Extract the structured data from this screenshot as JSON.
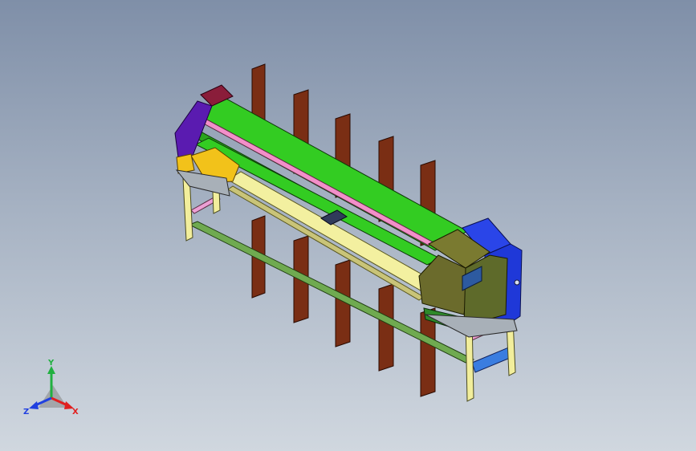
{
  "viewport": {
    "background_top": "#7f8fa8",
    "background_bottom": "#d0d7df"
  },
  "triad": {
    "x_label": "X",
    "y_label": "Y",
    "z_label": "Z",
    "x_color": "#e02020",
    "y_color": "#20b040",
    "z_color": "#2040e0"
  },
  "colors": {
    "frame": "#f2ee9c",
    "frame_pink": "#ec9fd4",
    "frame_green": "#6faa50",
    "top_rail": "#33cc22",
    "roller": "#f3f0a0",
    "pink_rail": "#f28fc9",
    "post": "#6b2a12",
    "post_light": "#a6542a",
    "left_cap": "#5a1bb0",
    "left_cap_top": "#8a1d3a",
    "left_yellow": "#f2c21a",
    "right_box": "#6b6b2c",
    "right_blue": "#2a45e8",
    "right_screen": "#2d5aa0",
    "right_green": "#2e8a2a",
    "base_blue": "#3a7de0"
  }
}
